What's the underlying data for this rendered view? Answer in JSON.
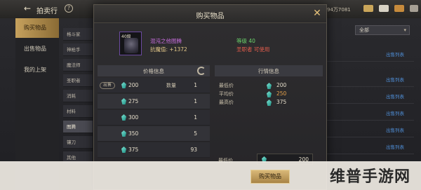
{
  "topbar": {
    "title": "拍卖行",
    "right_id": "94万7081",
    "icons": [
      "back-arrow-icon",
      "help-icon",
      "gold-icon",
      "mail-icon",
      "chest-icon",
      "menu-icon"
    ]
  },
  "sidebar": {
    "tabs": [
      {
        "label": "购买物品",
        "active": true
      },
      {
        "label": "出售物品",
        "active": false
      },
      {
        "label": "我的上架",
        "active": false
      }
    ]
  },
  "categories": [
    {
      "label": "格斗家",
      "active": false
    },
    {
      "label": "神枪手",
      "active": false
    },
    {
      "label": "魔法师",
      "active": false
    },
    {
      "label": "圣职者",
      "active": false
    },
    {
      "label": "消耗",
      "active": false
    },
    {
      "label": "材料",
      "active": false
    },
    {
      "label": "图腾",
      "active": true
    },
    {
      "label": "镶刀",
      "active": false
    },
    {
      "label": "其他",
      "active": false
    }
  ],
  "right_panel": {
    "sort_value": "全部",
    "row_link": "出售列表"
  },
  "modal": {
    "title": "购买物品",
    "item": {
      "level_badge": "40级",
      "name": "混沌之他图腾",
      "stat": "抗魔值: +1372",
      "req_level": "等级 40",
      "req_class": "圣职者 可使用"
    },
    "price_table": {
      "header": "价格信息",
      "sell_tag": "出售",
      "qty_label": "数量",
      "rows": [
        {
          "price": "200",
          "qty": "1"
        },
        {
          "price": "275",
          "qty": "1"
        },
        {
          "price": "300",
          "qty": "1"
        },
        {
          "price": "350",
          "qty": "5"
        },
        {
          "price": "375",
          "qty": "93"
        }
      ]
    },
    "market": {
      "header": "行情信息",
      "rows": [
        {
          "label": "最低价",
          "value": "200",
          "color": "#e8e0cc"
        },
        {
          "label": "平均价",
          "value": "250",
          "color": "#e6a24a"
        },
        {
          "label": "最高价",
          "value": "375",
          "color": "#e8e0cc"
        }
      ]
    },
    "buy": {
      "label": "最低价",
      "price": "200",
      "button": "购买物品"
    }
  },
  "watermark": "维普手游网",
  "colors": {
    "accent_gold": "#c6a15d",
    "item_name": "#c46bd9",
    "req_ok": "#6ad36a",
    "req_bad": "#e25c4c",
    "link_blue": "#4f8fd8",
    "gem": "#2fb8a8"
  }
}
